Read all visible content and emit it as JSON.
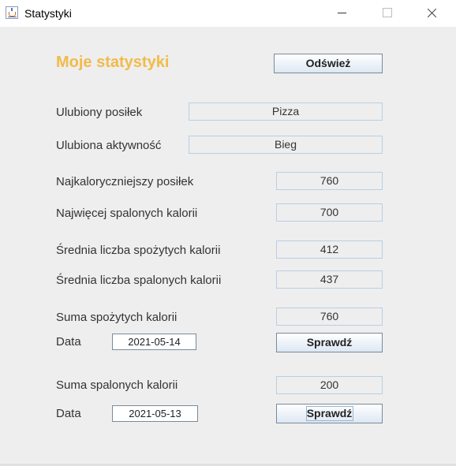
{
  "window": {
    "title": "Statystyki"
  },
  "heading": "Moje statystyki",
  "refresh_button": "Odśwież",
  "favorite_meal": {
    "label": "Ulubiony posiłek",
    "value": "Pizza"
  },
  "favorite_activity": {
    "label": "Ulubiona aktywność",
    "value": "Bieg"
  },
  "max_calorie_meal": {
    "label": "Najkaloryczniejszy posiłek",
    "value": "760"
  },
  "max_burned": {
    "label": "Najwięcej spalonych kalorii",
    "value": "700"
  },
  "avg_consumed": {
    "label": "Średnia liczba spożytych kalorii",
    "value": "412"
  },
  "avg_burned": {
    "label": "Średnia liczba spalonych kalorii",
    "value": "437"
  },
  "sum_consumed": {
    "label": "Suma spożytych kalorii",
    "value": "760",
    "date_label": "Data",
    "date": "2021-05-14",
    "button": "Sprawdź"
  },
  "sum_burned": {
    "label": "Suma spalonych kalorii",
    "value": "200",
    "date_label": "Data",
    "date": "2021-05-13",
    "button": "Sprawdź"
  }
}
